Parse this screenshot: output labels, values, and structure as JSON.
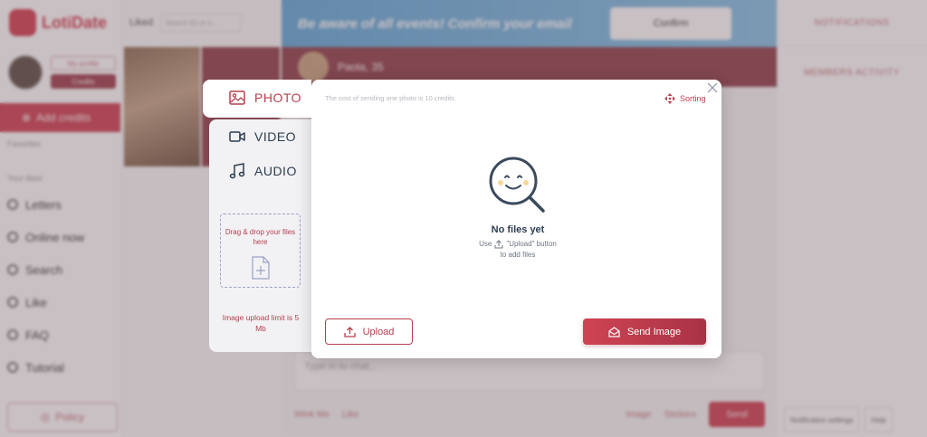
{
  "app": {
    "logo_text": "LotiDate",
    "profile": {
      "btn_top": "My profile",
      "btn_bottom": "Credits"
    },
    "add_credits": "Add credits",
    "small_labels": [
      "Favorites",
      "Your likes"
    ],
    "menu": [
      "Letters",
      "Online now",
      "Search",
      "Like",
      "FAQ",
      "Tutorial"
    ],
    "policy": "Policy",
    "girls_header": "Liked",
    "girls_search_placeholder": "Search ID or n...",
    "banner_text": "Be aware of all events! Confirm your email",
    "banner_button": "Confirm",
    "chat_name": "Paola, 35",
    "composer_placeholder": "Type in to chat...",
    "bottom_actions": [
      "Wink Me",
      "Like",
      "Image",
      "Stickers"
    ],
    "send_label": "Send",
    "right_labels": [
      "NOTIFICATIONS",
      "MEMBERS ACTIVITY"
    ],
    "right_bottom": [
      "Notification settings",
      "Help"
    ]
  },
  "modal": {
    "tabs": [
      {
        "label": "PHOTO",
        "active": true,
        "icon": "image-icon"
      },
      {
        "label": "VIDEO",
        "active": false,
        "icon": "video-camera-icon"
      },
      {
        "label": "AUDIO",
        "active": false,
        "icon": "music-note-icon"
      }
    ],
    "cost_note": "The cost of sending one photo is 10 credits",
    "sorting_label": "Sorting",
    "dropzone_text": "Drag & drop your files here",
    "upload_limit": "Image upload limit is 5 Mb",
    "empty_title": "No files yet",
    "empty_hint_prefix": "Use",
    "empty_hint_suffix": "\"Upload\" button",
    "empty_hint_line2": "to add files",
    "upload_button": "Upload",
    "send_button": "Send Image"
  },
  "colors": {
    "accent": "#b5404f",
    "text_dark": "#2c3e50",
    "tabs_bg": "#f2f1f4",
    "overlay": "rgba(110,90,98,0.38)"
  }
}
